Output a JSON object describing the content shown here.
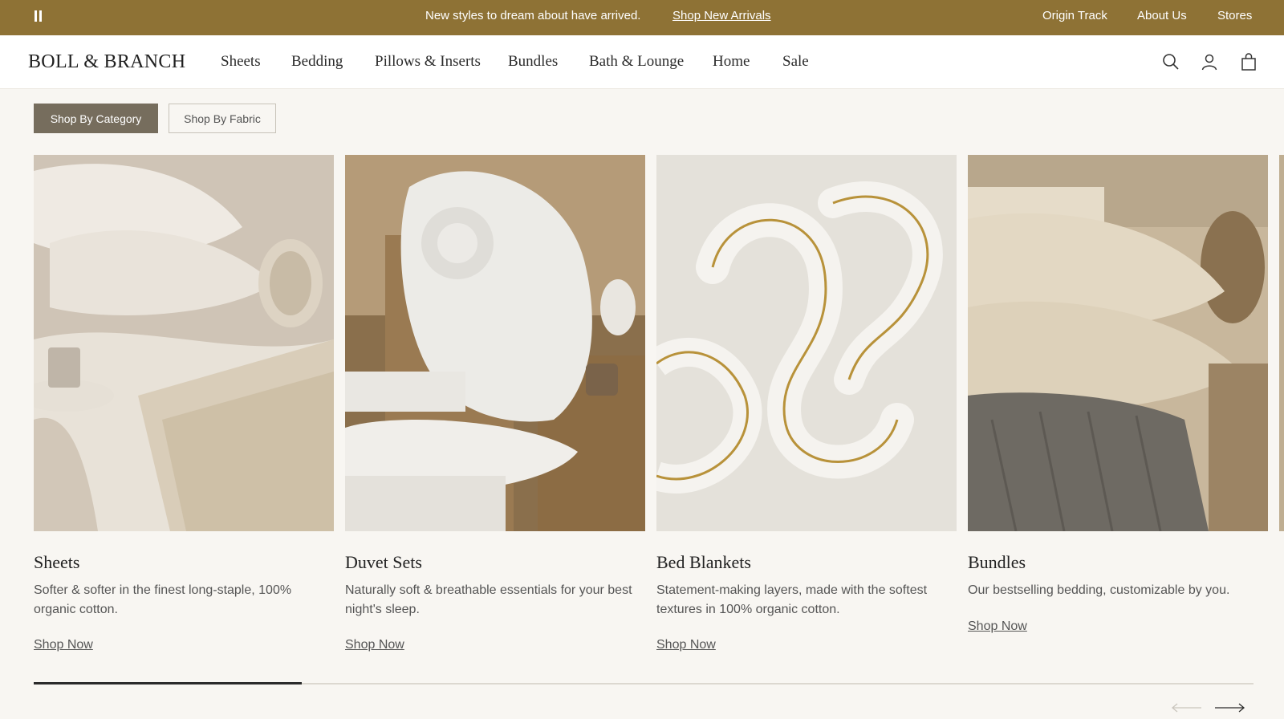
{
  "announcement": {
    "message": "New styles to dream about have arrived.",
    "link": "Shop New Arrivals",
    "utility_links": [
      "Origin Track",
      "About Us",
      "Stores"
    ]
  },
  "header": {
    "logo": "BOLL & BRANCH",
    "nav": [
      "Sheets",
      "Bedding",
      "Pillows & Inserts",
      "Bundles",
      "Bath & Lounge",
      "Home",
      "Sale"
    ]
  },
  "filters": {
    "by_category": "Shop By Category",
    "by_fabric": "Shop By Fabric",
    "active": "Shop By Category"
  },
  "cards": [
    {
      "title": "Sheets",
      "description": "Softer & softer in the finest long-staple, 100% organic cotton.",
      "link": "Shop Now"
    },
    {
      "title": "Duvet Sets",
      "description": "Naturally soft & breathable essentials for your best night's sleep.",
      "link": "Shop Now"
    },
    {
      "title": "Bed Blankets",
      "description": "Statement-making layers, made with the softest textures in 100% organic cotton.",
      "link": "Shop Now"
    },
    {
      "title": "Bundles",
      "description": "Our bestselling bedding, customizable by you.",
      "link": "Shop Now"
    }
  ],
  "carousel": {
    "progress": 0.22
  },
  "icons": [
    "pause-icon",
    "search-icon",
    "account-icon",
    "cart-icon",
    "arrow-left-icon",
    "arrow-right-icon"
  ],
  "colors": {
    "announcement_bg": "#8e7235",
    "active_chip": "#766d5d",
    "page_bg": "#f8f6f2"
  }
}
